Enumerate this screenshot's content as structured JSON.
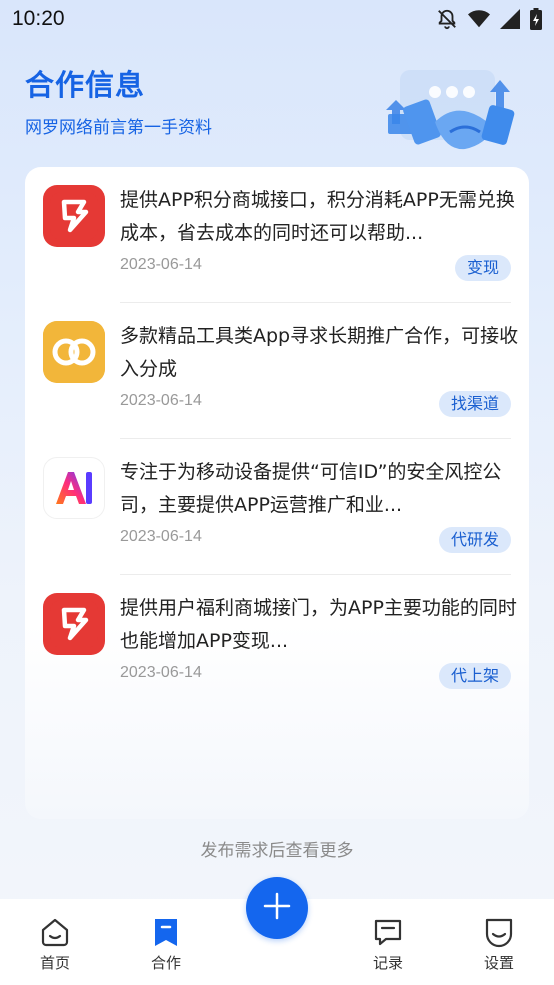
{
  "status_bar": {
    "time": "10:20",
    "icons": [
      "notifications-off-icon",
      "wifi-icon",
      "signal-icon",
      "battery-charging-icon"
    ]
  },
  "header": {
    "title": "合作信息",
    "subtitle": "网罗网络前言第一手资料",
    "illustration": "handshake-illustration"
  },
  "items": [
    {
      "icon": "red-logo-icon",
      "title": "提供APP积分商城接口，积分消耗APP无需兑换成本，省去成本的同时还可以帮助...",
      "date": "2023-06-14",
      "tag": "变现"
    },
    {
      "icon": "infinity-logo-icon",
      "title": "多款精品工具类App寻求长期推广合作，可接收入分成",
      "date": "2023-06-14",
      "tag": "找渠道"
    },
    {
      "icon": "ai-logo-icon",
      "title": "专注于为移动设备提供“可信ID”的安全风控公司，主要提供APP运营推广和业...",
      "date": "2023-06-14",
      "tag": "代研发"
    },
    {
      "icon": "red-logo-icon",
      "title": "提供用户福利商城接门，为APP主要功能的同时也能增加APP变现...",
      "date": "2023-06-14",
      "tag": "代上架"
    }
  ],
  "more_text": "发布需求后查看更多",
  "bottom_nav": {
    "items": [
      {
        "label": "首页",
        "icon": "home-icon",
        "active": false
      },
      {
        "label": "合作",
        "icon": "bookmark-icon",
        "active": true
      },
      {
        "label": "记录",
        "icon": "message-icon",
        "active": false
      },
      {
        "label": "设置",
        "icon": "settings-icon",
        "active": false
      }
    ],
    "fab_icon": "plus-icon"
  },
  "colors": {
    "accent": "#1466ee",
    "title_blue": "#1663e4",
    "tag_bg": "#dbe8fb",
    "tag_text": "#1a5fd0",
    "red_logo": "#e53935",
    "yellow_logo": "#f2b63a"
  }
}
